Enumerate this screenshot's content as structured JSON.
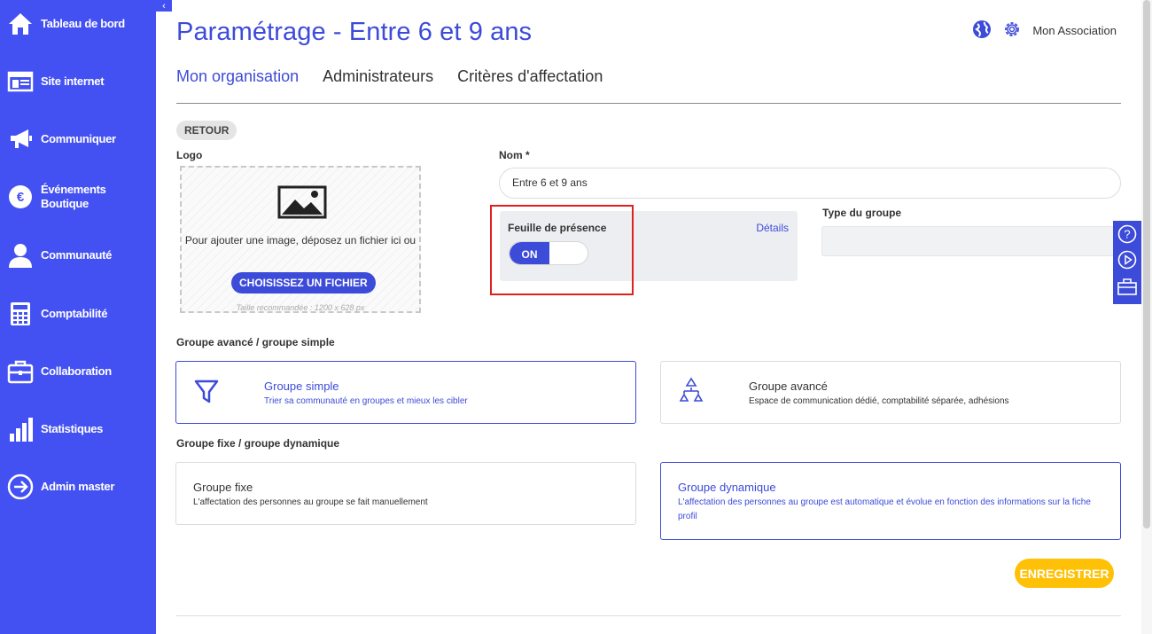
{
  "sidebar": {
    "items": [
      {
        "label": "Tableau de bord",
        "icon": "home-icon"
      },
      {
        "label": "Site internet",
        "icon": "website-icon"
      },
      {
        "label": "Communiquer",
        "icon": "megaphone-icon"
      },
      {
        "label": "Événements",
        "label2": "Boutique",
        "icon": "euro-icon"
      },
      {
        "label": "Communauté",
        "icon": "user-icon"
      },
      {
        "label": "Comptabilité",
        "icon": "calculator-icon"
      },
      {
        "label": "Collaboration",
        "icon": "briefcase-icon"
      },
      {
        "label": "Statistiques",
        "icon": "bar-chart-icon"
      },
      {
        "label": "Admin master",
        "icon": "arrow-circle-icon"
      }
    ]
  },
  "header": {
    "title": "Paramétrage - Entre 6 et 9 ans",
    "account": "Mon Association"
  },
  "tabs": [
    {
      "label": "Mon organisation"
    },
    {
      "label": "Administrateurs"
    },
    {
      "label": "Critères d'affectation"
    }
  ],
  "form": {
    "back_label": "RETOUR",
    "logo_label": "Logo",
    "logo_drop_text": "Pour ajouter une image, déposez un fichier ici ou",
    "choose_file": "CHOISISSEZ UN FICHIER",
    "logo_hint": "Taille recommandée : 1200 x 628 px",
    "name_label": "Nom *",
    "name_value": "Entre 6 et 9 ans",
    "presence_title": "Feuille de présence",
    "presence_details": "Détails",
    "presence_toggle": "ON",
    "type_label": "Type du groupe",
    "group_kind_label": "Groupe avancé / groupe simple",
    "simple_title": "Groupe simple",
    "simple_desc": "Trier sa communauté en groupes et mieux les cibler",
    "advanced_title": "Groupe avancé",
    "advanced_desc": "Espace de communication dédié, comptabilité séparée, adhésions",
    "group_mode_label": "Groupe fixe / groupe dynamique",
    "fixed_title": "Groupe fixe",
    "fixed_desc": "L'affectation des personnes au groupe se fait manuellement",
    "dynamic_title": "Groupe dynamique",
    "dynamic_desc": "L'affectation des personnes au groupe est automatique et évolue en fonction des informations sur la fiche profil",
    "save_label": "ENREGISTRER"
  },
  "colors": {
    "brand": "#4451f2",
    "accent": "#3d4bd9",
    "save": "#ffc107",
    "highlight": "#e0201e"
  }
}
